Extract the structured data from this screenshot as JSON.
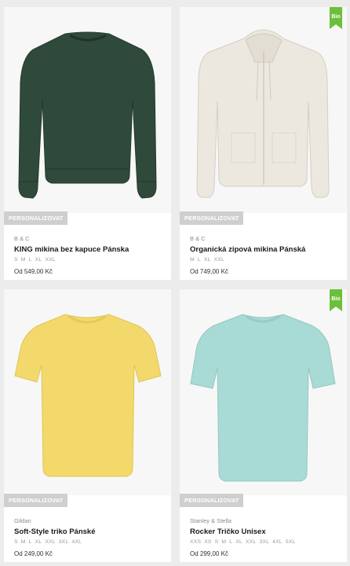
{
  "products": [
    {
      "brand": "B & C",
      "title": "KING mikina bez kapuce Pánska",
      "sizes": [
        "S",
        "M",
        "L",
        "XL",
        "XXL"
      ],
      "price": "Od 549,00 Kč",
      "personalize": "PERSONALIZOVAT",
      "color": "#2f4a3a",
      "garment": "sweatshirt",
      "bio": false
    },
    {
      "brand": "B & C",
      "title": "Organická zipová mikina Pánská",
      "sizes": [
        "M",
        "L",
        "XL",
        "XXL"
      ],
      "price": "Od 749,00 Kč",
      "personalize": "PERSONALIZOVAT",
      "color": "#ece8df",
      "garment": "hoodie",
      "bio": true,
      "bio_label": "Bio"
    },
    {
      "brand": "Gildan",
      "title": "Soft-Style triko Pánské",
      "sizes": [
        "S",
        "M",
        "L",
        "XL",
        "XXL",
        "3XL",
        "4XL"
      ],
      "price": "Od 249,00 Kč",
      "personalize": "PERSONALIZOVAT",
      "color": "#f3d96b",
      "garment": "tshirt",
      "bio": false
    },
    {
      "brand": "Stanley & Stella",
      "title": "Rocker Tričko Unisex",
      "sizes": [
        "XXS",
        "XS",
        "S",
        "M",
        "L",
        "XL",
        "XXL",
        "3XL",
        "4XL",
        "5XL"
      ],
      "price": "Od 299,00 Kč",
      "personalize": "PERSONALIZOVAT",
      "color": "#a9dbd6",
      "garment": "tshirt",
      "bio": true,
      "bio_label": "Bio"
    }
  ],
  "colors": {
    "bio_badge": "#6cbf3a",
    "page_bg": "#ececec"
  }
}
